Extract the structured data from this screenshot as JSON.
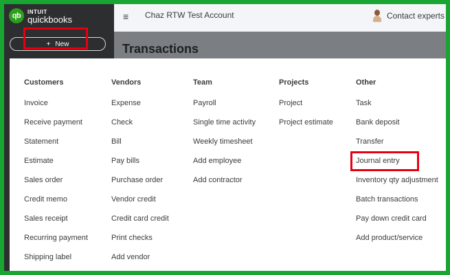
{
  "app": {
    "logo_badge": "qb",
    "logo_line1": "INTUIT",
    "logo_line2": "quickbooks",
    "account_name": "Chaz RTW Test Account",
    "contact_label": "Contact experts",
    "hamburger_glyph": "≡"
  },
  "sidebar": {
    "new_plus": "+",
    "new_label": "New"
  },
  "page": {
    "title": "Transactions"
  },
  "menu": {
    "columns": [
      {
        "header": "Customers",
        "items": [
          "Invoice",
          "Receive payment",
          "Statement",
          "Estimate",
          "Sales order",
          "Credit memo",
          "Sales receipt",
          "Recurring payment",
          "Shipping label"
        ]
      },
      {
        "header": "Vendors",
        "items": [
          "Expense",
          "Check",
          "Bill",
          "Pay bills",
          "Purchase order",
          "Vendor credit",
          "Credit card credit",
          "Print checks",
          "Add vendor"
        ]
      },
      {
        "header": "Team",
        "items": [
          "Payroll",
          "Single time activity",
          "Weekly timesheet",
          "Add employee",
          "Add contractor"
        ]
      },
      {
        "header": "Projects",
        "items": [
          "Project",
          "Project estimate"
        ]
      },
      {
        "header": "Other",
        "items": [
          "Task",
          "Bank deposit",
          "Transfer",
          "Journal entry",
          "Inventory qty adjustment",
          "Batch transactions",
          "Pay down credit card",
          "Add product/service"
        ]
      }
    ]
  },
  "colors": {
    "brand_green": "#2ca01c",
    "frame_green": "#18a532",
    "highlight_red": "#e6000f",
    "sidebar_bg": "#2d2e30"
  },
  "icons": [
    "hamburger-icon",
    "person-icon",
    "plus-icon"
  ]
}
